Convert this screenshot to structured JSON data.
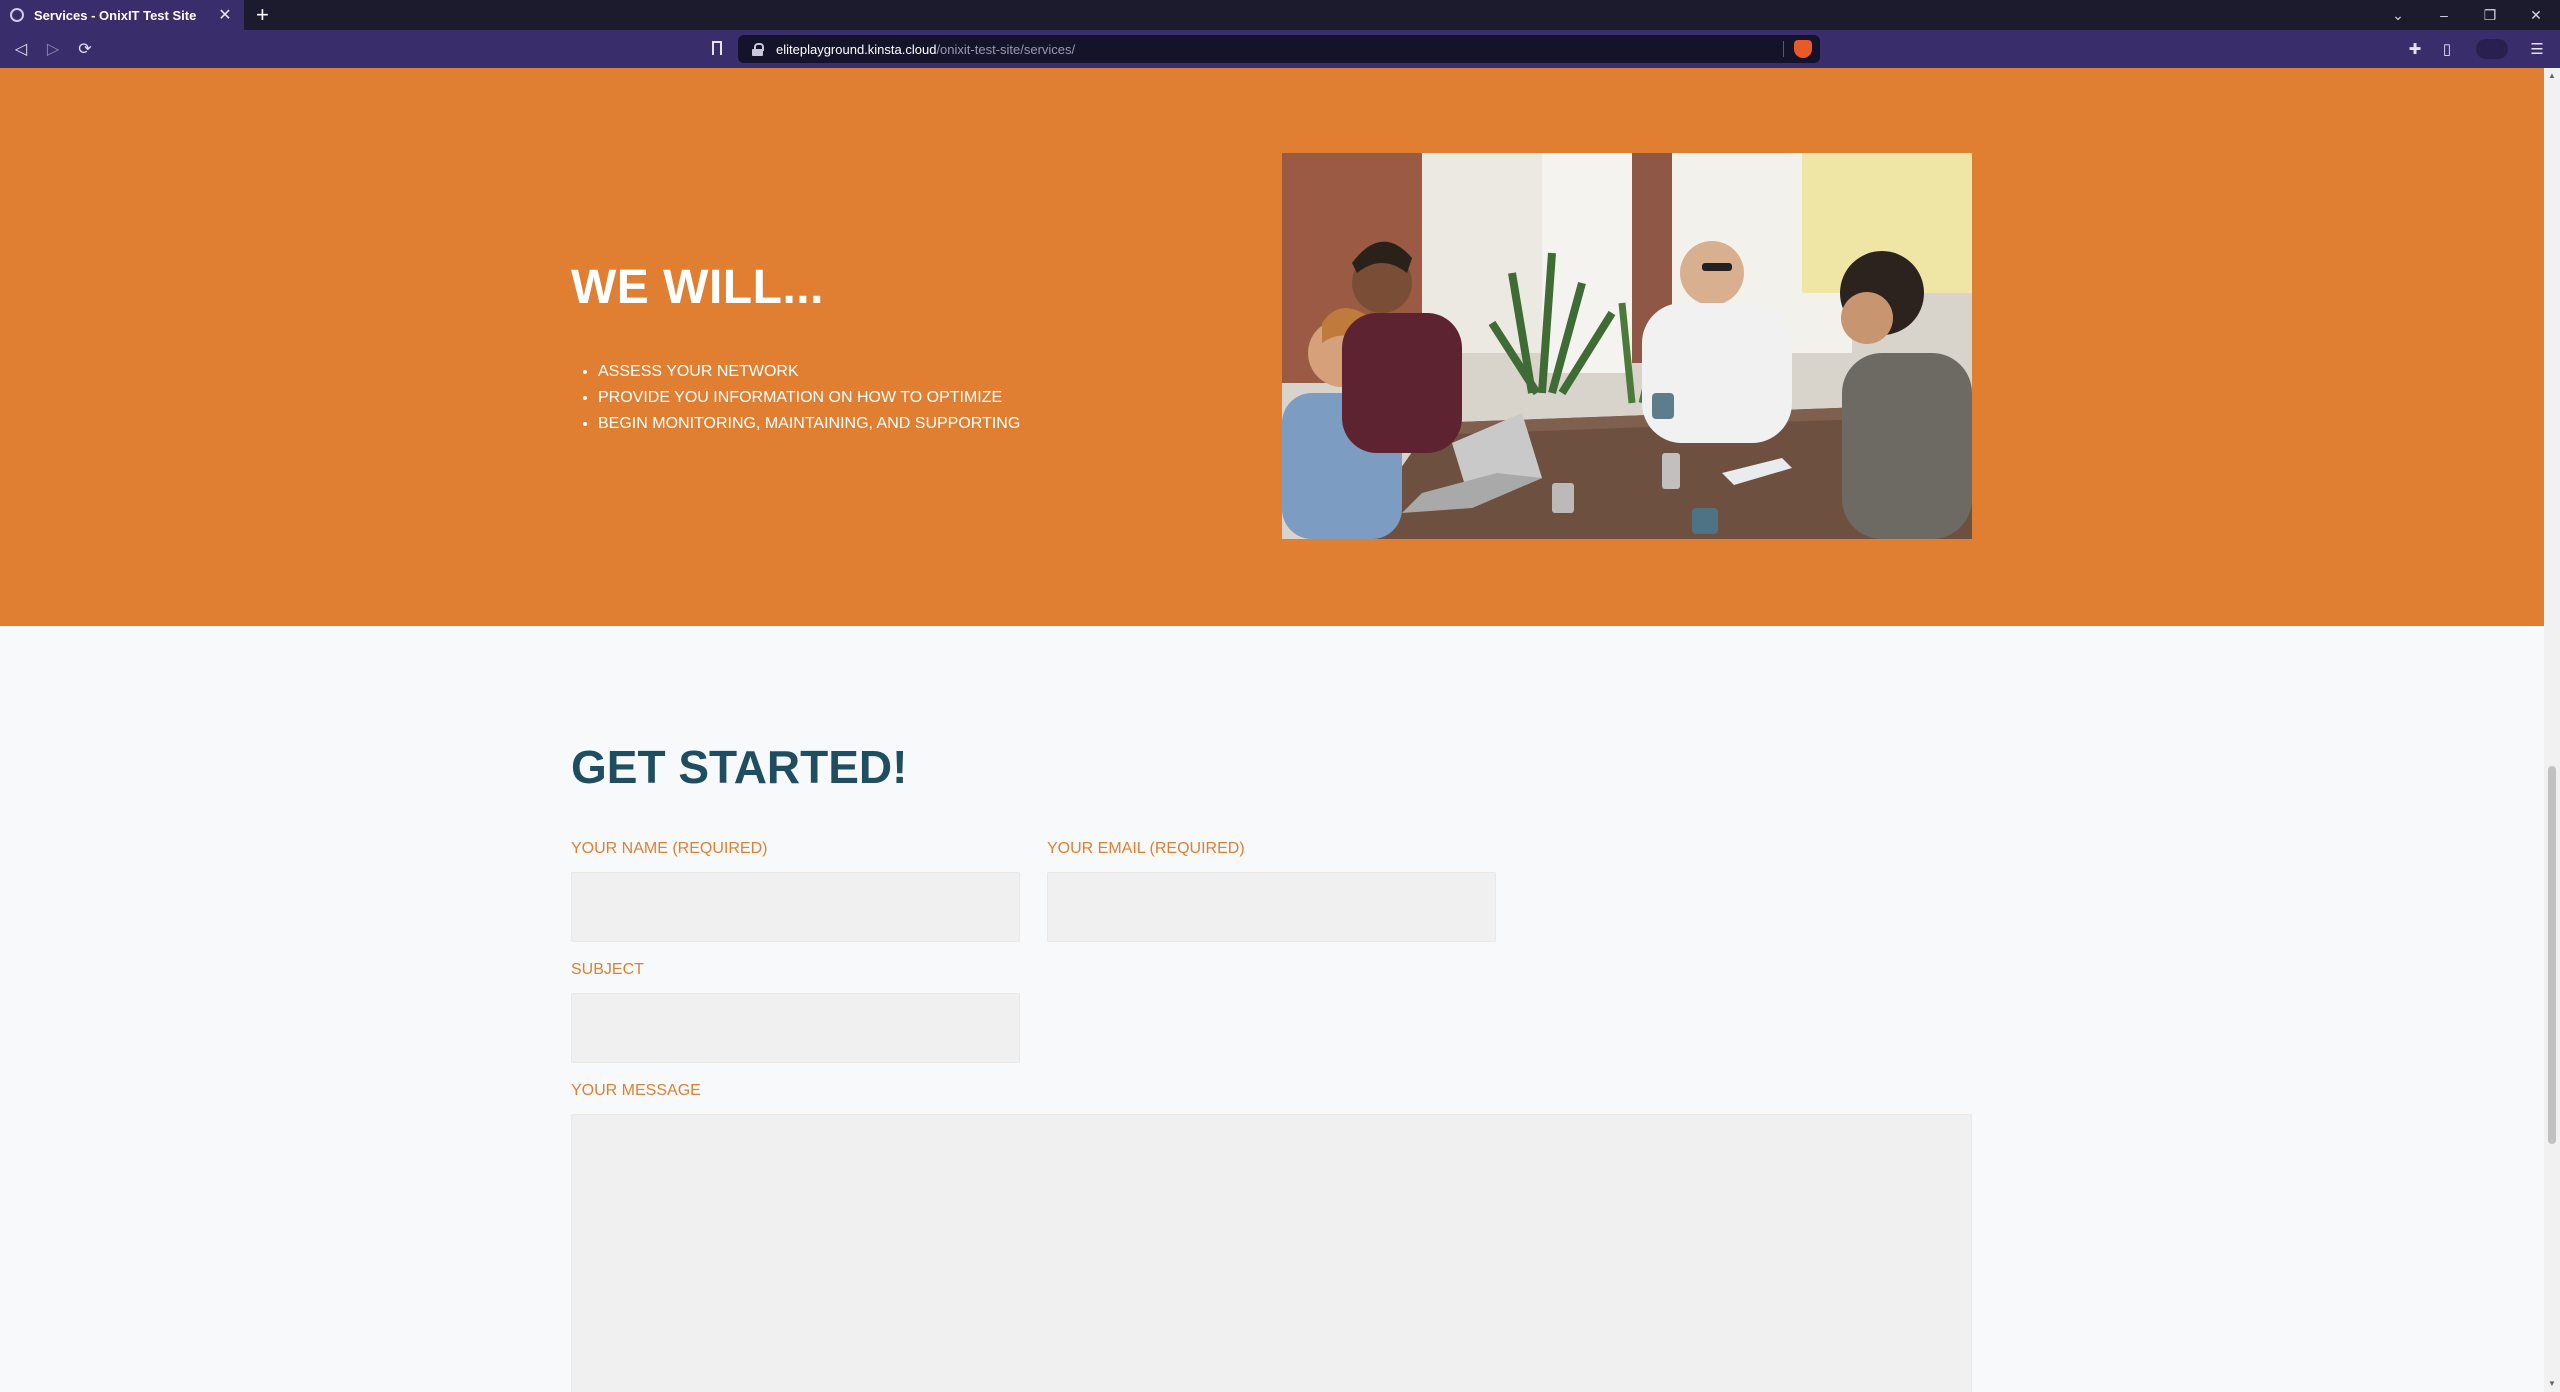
{
  "browser": {
    "tab_title": "Services - OnixIT Test Site",
    "tab_close": "✕",
    "new_tab": "+",
    "url_host": "eliteplayground.kinsta.cloud",
    "url_path": "/onixit-test-site/services/",
    "icons": {
      "back": "◁",
      "forward": "▷",
      "reload": "⟳",
      "extensions": "✚",
      "sidebar": "▯",
      "menu": "☰",
      "tab_list": "⌄",
      "minimize": "–",
      "restore": "❐",
      "close": "✕"
    }
  },
  "services": {
    "heading": "WE WILL...",
    "items": [
      "ASSESS YOUR NETWORK",
      "PROVIDE YOU INFORMATION ON HOW TO OPTIMIZE",
      "BEGIN MONITORING, MAINTAINING, AND SUPPORTING"
    ],
    "background_color": "#e07f32"
  },
  "form": {
    "heading": "GET STARTED!",
    "name_label": "YOUR NAME (REQUIRED)",
    "email_label": "YOUR EMAIL (REQUIRED)",
    "subject_label": "SUBJECT",
    "message_label": "YOUR MESSAGE",
    "name_value": "",
    "email_value": "",
    "subject_value": "",
    "message_value": "",
    "label_color": "#e07f32",
    "heading_color": "#1f4e61"
  }
}
